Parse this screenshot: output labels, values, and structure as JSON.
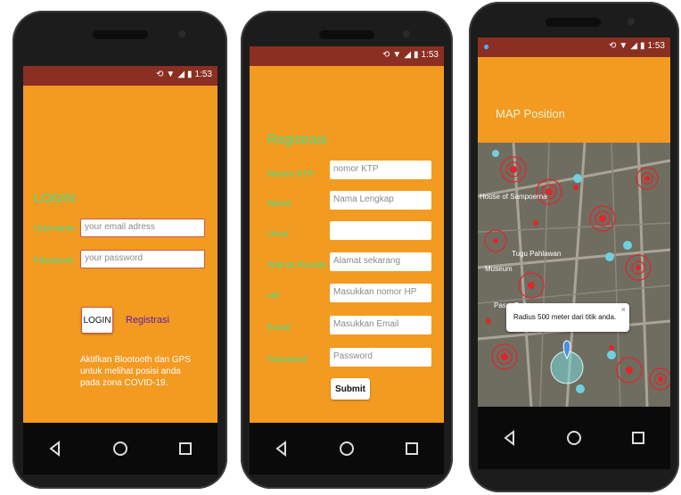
{
  "status": {
    "time": "1:53"
  },
  "login": {
    "title": "LOGIN",
    "username_label": "Username",
    "username_placeholder": "your email adress",
    "password_label": "Password",
    "password_placeholder": "your password",
    "login_button": "LOGIN",
    "register_link": "Registrasi",
    "info_text": "Aktifkan Blootooth dan GPS untuk melihat posisi anda pada zona COVID-19."
  },
  "register": {
    "title": "Registrasi",
    "fields": [
      {
        "label": "Nomor KTP",
        "placeholder": "nomor KTP"
      },
      {
        "label": "Nama",
        "placeholder": "Nama Lengkap"
      },
      {
        "label": "Umur",
        "placeholder": ""
      },
      {
        "label": "Alamat Rumah",
        "placeholder": "Alamat sekarang"
      },
      {
        "label": "HP",
        "placeholder": "Masukkan nomor HP"
      },
      {
        "label": "Email",
        "placeholder": "Masukkan Email"
      },
      {
        "label": "Password",
        "placeholder": "Password"
      }
    ],
    "submit_button": "Submit"
  },
  "map": {
    "title": "MAP Position",
    "popup_text": "Radius 500 meter dari titik anda.",
    "place_labels": [
      "Tugu Pahlawan",
      "Museum",
      "House of Sampoerna",
      "Pasar Turi"
    ]
  },
  "colors": {
    "screen_bg": "#f39a21",
    "statusbar": "#8b2f22",
    "accent_green": "#3fe08b",
    "zone_red": "#e0262a"
  }
}
